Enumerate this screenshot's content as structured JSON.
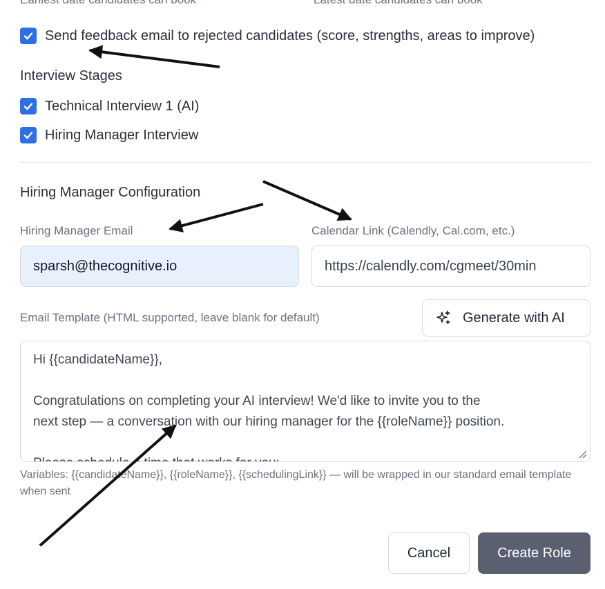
{
  "top_cut_labels": {
    "left": "Earliest date candidates can book",
    "right": "Latest date candidates can book"
  },
  "feedback_checkbox": {
    "label": "Send feedback email to rejected candidates (score, strengths, areas to improve)",
    "checked": true
  },
  "interview_stages": {
    "heading": "Interview Stages",
    "items": [
      {
        "label": "Technical Interview 1 (AI)",
        "checked": true
      },
      {
        "label": "Hiring Manager Interview",
        "checked": true
      }
    ]
  },
  "hiring_manager": {
    "heading": "Hiring Manager Configuration",
    "email_label": "Hiring Manager Email",
    "email_value": "sparsh@thecognitive.io",
    "calendar_label": "Calendar Link (Calendly, Cal.com, etc.)",
    "calendar_value": "https://calendly.com/cgmeet/30min"
  },
  "email_template": {
    "label": "Email Template (HTML supported, leave blank for default)",
    "generate_button": "Generate with AI",
    "lines": [
      "Hi {{candidateName}},",
      "",
      "Congratulations on completing your AI interview! We'd like to invite you to the",
      "next step — a conversation with our hiring manager for the {{roleName}} position.",
      "",
      "Please schedule a time that works for you:"
    ],
    "hint": "Variables: {{candidateName}}, {{roleName}}, {{schedulingLink}} — will be wrapped in our standard email template when sent"
  },
  "footer": {
    "cancel": "Cancel",
    "create": "Create Role"
  },
  "colors": {
    "checkbox": "#2f6fe4",
    "filled_input": "#e8effd",
    "primary_button": "#5b6070"
  },
  "icons": {
    "checkbox": "check-icon",
    "generate": "sparkles-icon",
    "resize": "resize-grip-icon"
  }
}
